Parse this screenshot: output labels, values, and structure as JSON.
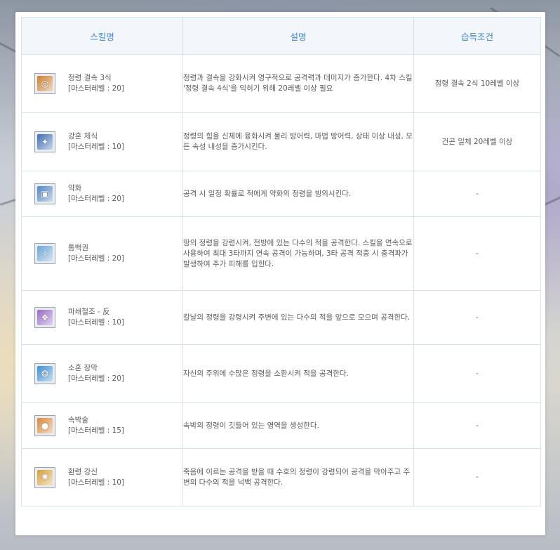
{
  "headers": {
    "name": "스킬명",
    "desc": "설명",
    "cond": "습득조건"
  },
  "rows": [
    {
      "name": "정령 결속 3식",
      "master": "[마스터레벨 : 20]",
      "desc": "정령과 결속을 강화시켜 영구적으로 공격력과 데미지가 증가한다. 4차 스킬 '정령 결속 4식'을 익히기 위해 20레벨 이상 필요",
      "cond": "정령 결속 2식 10레벨 이상",
      "icon": "spirit-bond-icon",
      "icon_color": "#c9802f",
      "icon_glyph": "◎"
    },
    {
      "name": "강혼 체식",
      "master": "[마스터레벨 : 10]",
      "desc": "정령의 힘을 신체에 융화시켜 물리 방어력, 마법 방어력, 상태 이상 내성, 모든 속성 내성을 증가시킨다.",
      "cond": "건곤 일체 20레벨 이상",
      "icon": "body-fusion-icon",
      "icon_color": "#3f6fb3",
      "icon_glyph": "✦"
    },
    {
      "name": "약화",
      "master": "[마스터레벨 : 20]",
      "desc": "공격 시 일정 확률로 적에게 약화의 정령을 빙의시킨다.",
      "cond": "-",
      "icon": "weaken-icon",
      "icon_color": "#4f86c8",
      "icon_glyph": "▣"
    },
    {
      "name": "통백권",
      "master": "[마스터레벨 : 20]",
      "desc": "땅의 정령을 강령시켜, 전방에 있는 다수의 적을 공격한다. 스킬을 연속으로 사용하여 최대 3타까지 연속 공격이 가능하며, 3타 공격 적중 시 충격파가 발생하여 추가 피해를 입힌다.",
      "cond": "-",
      "icon": "fist-icon",
      "icon_color": "#6aa6d8",
      "icon_glyph": "✧"
    },
    {
      "name": "파쇄철조 - 反",
      "master": "[마스터레벨 : 10]",
      "desc": "칼날의 정령을 강령시켜 주변에 있는 다수의 적을 앞으로 모으며 공격한다.",
      "cond": "-",
      "icon": "blade-icon",
      "icon_color": "#9a6ac6",
      "icon_glyph": "❖"
    },
    {
      "name": "소혼 장막",
      "master": "[마스터레벨 : 20]",
      "desc": "자신의 주위에 수많은 정령을 소환시켜 적을 공격한다.",
      "cond": "-",
      "icon": "curtain-icon",
      "icon_color": "#3a8fd6",
      "icon_glyph": "❂"
    },
    {
      "name": "속박술",
      "master": "[마스터레벨 : 15]",
      "desc": "속박의 정령이 깃들어 있는 영역을 생성한다.",
      "cond": "-",
      "icon": "bind-icon",
      "icon_color": "#d9893a",
      "icon_glyph": "●"
    },
    {
      "name": "환령 강신",
      "master": "[마스터레벨 : 10]",
      "desc": "죽음에 이르는 공격을 받을 때 수호의 정령이 강령되어 공격을 막아주고 주변의 다수의 적을 넉백 공격한다.",
      "cond": "-",
      "icon": "guardian-icon",
      "icon_color": "#d8a13a",
      "icon_glyph": "✺"
    }
  ]
}
